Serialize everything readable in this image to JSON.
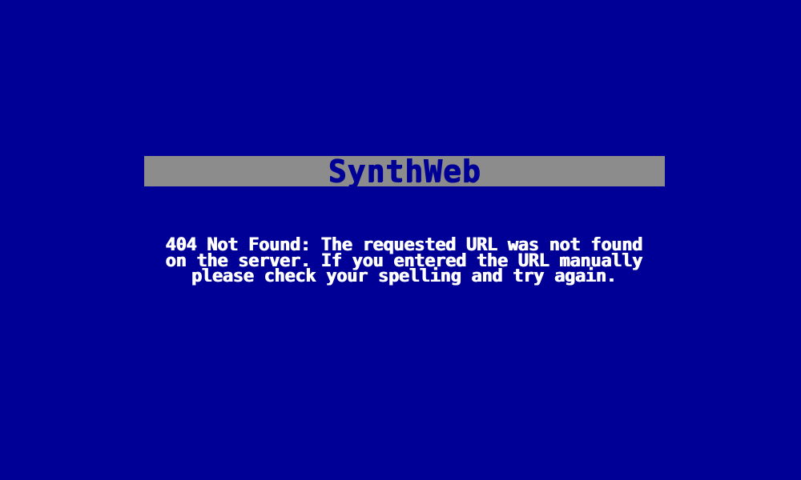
{
  "header": {
    "title": "SynthWeb"
  },
  "error": {
    "lines": [
      "404 Not Found: The requested URL was not found",
      "on the server. If you entered the URL manually",
      "please check your spelling and try again."
    ]
  },
  "colors": {
    "background": "#000096",
    "title_bar": "#8c8c8c",
    "title_text": "#000096",
    "message_text": "#ffffff"
  }
}
